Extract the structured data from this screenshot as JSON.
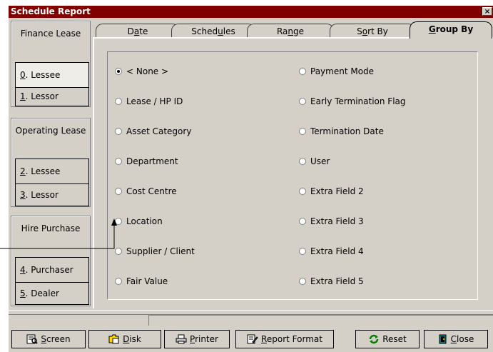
{
  "window": {
    "title": "Schedule Report",
    "close_glyph": "×"
  },
  "sidebar": {
    "finance_title": "Finance Lease",
    "finance_lessee_key": "0",
    "finance_lessee_label": ". Lessee",
    "finance_lessor_key": "1",
    "finance_lessor_label": ". Lessor",
    "operating_title": "Operating Lease",
    "operating_lessee_key": "2",
    "operating_lessee_label": ". Lessee",
    "operating_lessor_key": "3",
    "operating_lessor_label": ". Lessor",
    "hire_title": "Hire Purchase",
    "hire_purchaser_key": "4",
    "hire_purchaser_label": ". Purchaser",
    "hire_dealer_key": "5",
    "hire_dealer_label": ". Dealer",
    "selected": "Finance Lease / 0. Lessee"
  },
  "tabs": {
    "date_pre": "D",
    "date_u": "a",
    "date_post": "te",
    "schedules_pre": "Sched",
    "schedules_u": "u",
    "schedules_post": "les",
    "range_pre": "Ra",
    "range_u": "n",
    "range_post": "ge",
    "sortby_pre": "S",
    "sortby_u": "o",
    "sortby_post": "rt By",
    "groupby_pre": "",
    "groupby_u": "G",
    "groupby_post": "roup By",
    "active": "Group By"
  },
  "group_by": {
    "selected": "< None >",
    "options": [
      "< None >",
      "Lease / HP ID",
      "Asset Category",
      "Department",
      "Cost Centre",
      "Location",
      "Supplier / Client",
      "Fair Value",
      "Payment Mode",
      "Early Termination Flag",
      "Termination Date",
      "User",
      "Extra Field 2",
      "Extra Field 3",
      "Extra Field 4",
      "Extra Field 5"
    ]
  },
  "bottom": {
    "screen_u": "S",
    "screen_post": "creen",
    "disk_u": "D",
    "disk_post": "isk",
    "printer_u": "P",
    "printer_post": "rinter",
    "report_u": "R",
    "report_post": "eport Format",
    "reset_label": "Reset",
    "close_u": "C",
    "close_post": "lose"
  },
  "icons": [
    "close-icon",
    "screen-icon",
    "disk-icon",
    "printer-icon",
    "report-format-icon",
    "reset-icon",
    "close-door-icon"
  ]
}
